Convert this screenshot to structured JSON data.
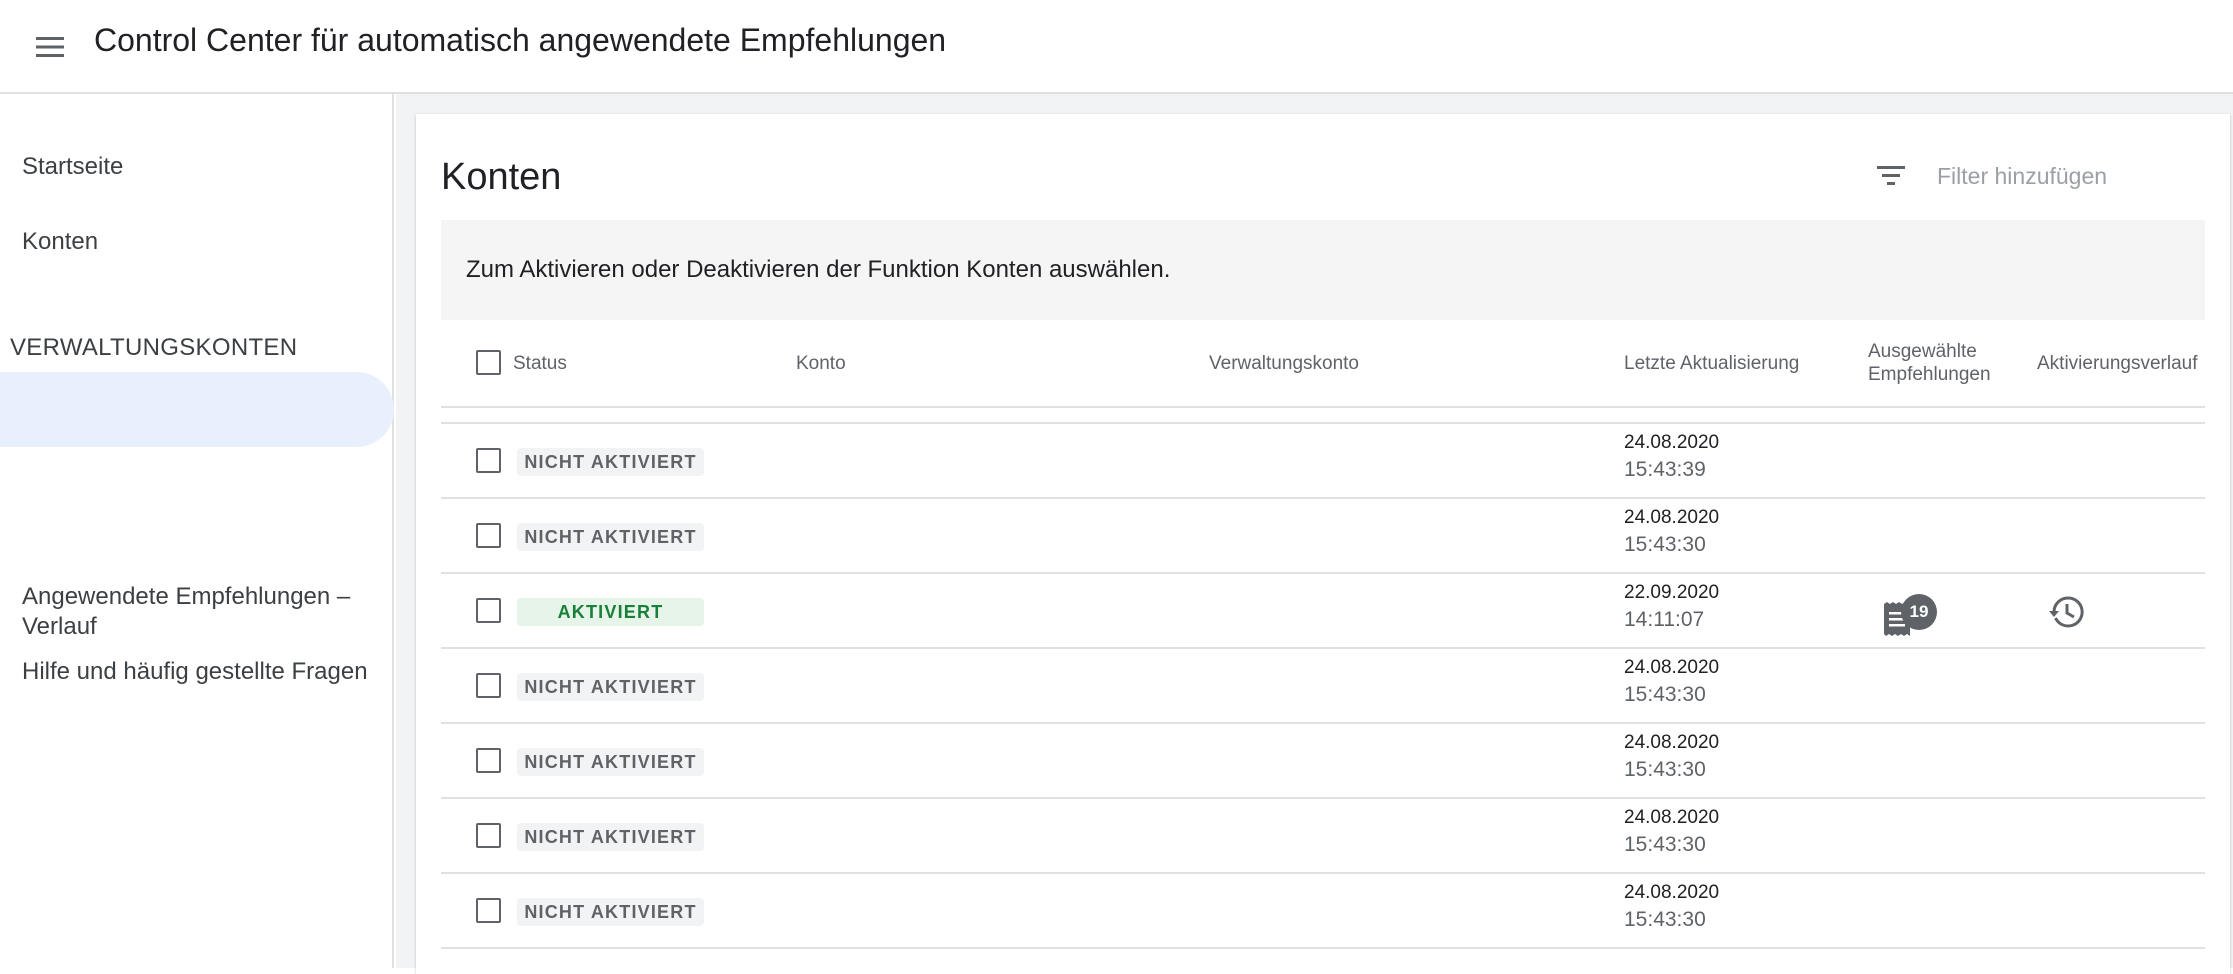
{
  "header": {
    "title": "Control Center für automatisch angewendete Empfehlungen",
    "menu_icon": "menu-icon"
  },
  "sidebar": {
    "nav": [
      {
        "label": "Startseite"
      },
      {
        "label": "Konten"
      }
    ],
    "section_header": "VERWALTUNGSKONTEN",
    "footer_links": [
      {
        "label": "Angewendete Empfehlungen – Verlauf"
      },
      {
        "label": "Hilfe und häufig gestellte Fragen"
      }
    ]
  },
  "main": {
    "title": "Konten",
    "filter": {
      "placeholder": "Filter hinzufügen",
      "icon": "filter-icon"
    },
    "banner": "Zum Aktivieren oder Deaktivieren der Funktion Konten auswählen.",
    "columns": {
      "status": "Status",
      "account": "Konto",
      "manager": "Verwaltungskonto",
      "updated": "Letzte Aktualisierung",
      "selected_line1": "Ausgewählte",
      "selected_line2": "Empfehlungen",
      "history": "Aktivierungsverlauf"
    },
    "rows": [
      {
        "status": "NICHT AKTIVIERT",
        "date": "24.08.2020",
        "time": "15:43:39"
      },
      {
        "status": "NICHT AKTIVIERT",
        "date": "24.08.2020",
        "time": "15:43:30"
      },
      {
        "status": "AKTIVIERT",
        "date": "22.09.2020",
        "time": "14:11:07",
        "recommendations_badge": "19"
      },
      {
        "status": "NICHT AKTIVIERT",
        "date": "24.08.2020",
        "time": "15:43:30"
      },
      {
        "status": "NICHT AKTIVIERT",
        "date": "24.08.2020",
        "time": "15:43:30"
      },
      {
        "status": "NICHT AKTIVIERT",
        "date": "24.08.2020",
        "time": "15:43:30"
      },
      {
        "status": "NICHT AKTIVIERT",
        "date": "24.08.2020",
        "time": "15:43:30"
      }
    ],
    "colors": {
      "active_green": "#188038",
      "active_bg": "#e6f4ea",
      "selected_nav_bg": "#e8f0fe"
    }
  }
}
